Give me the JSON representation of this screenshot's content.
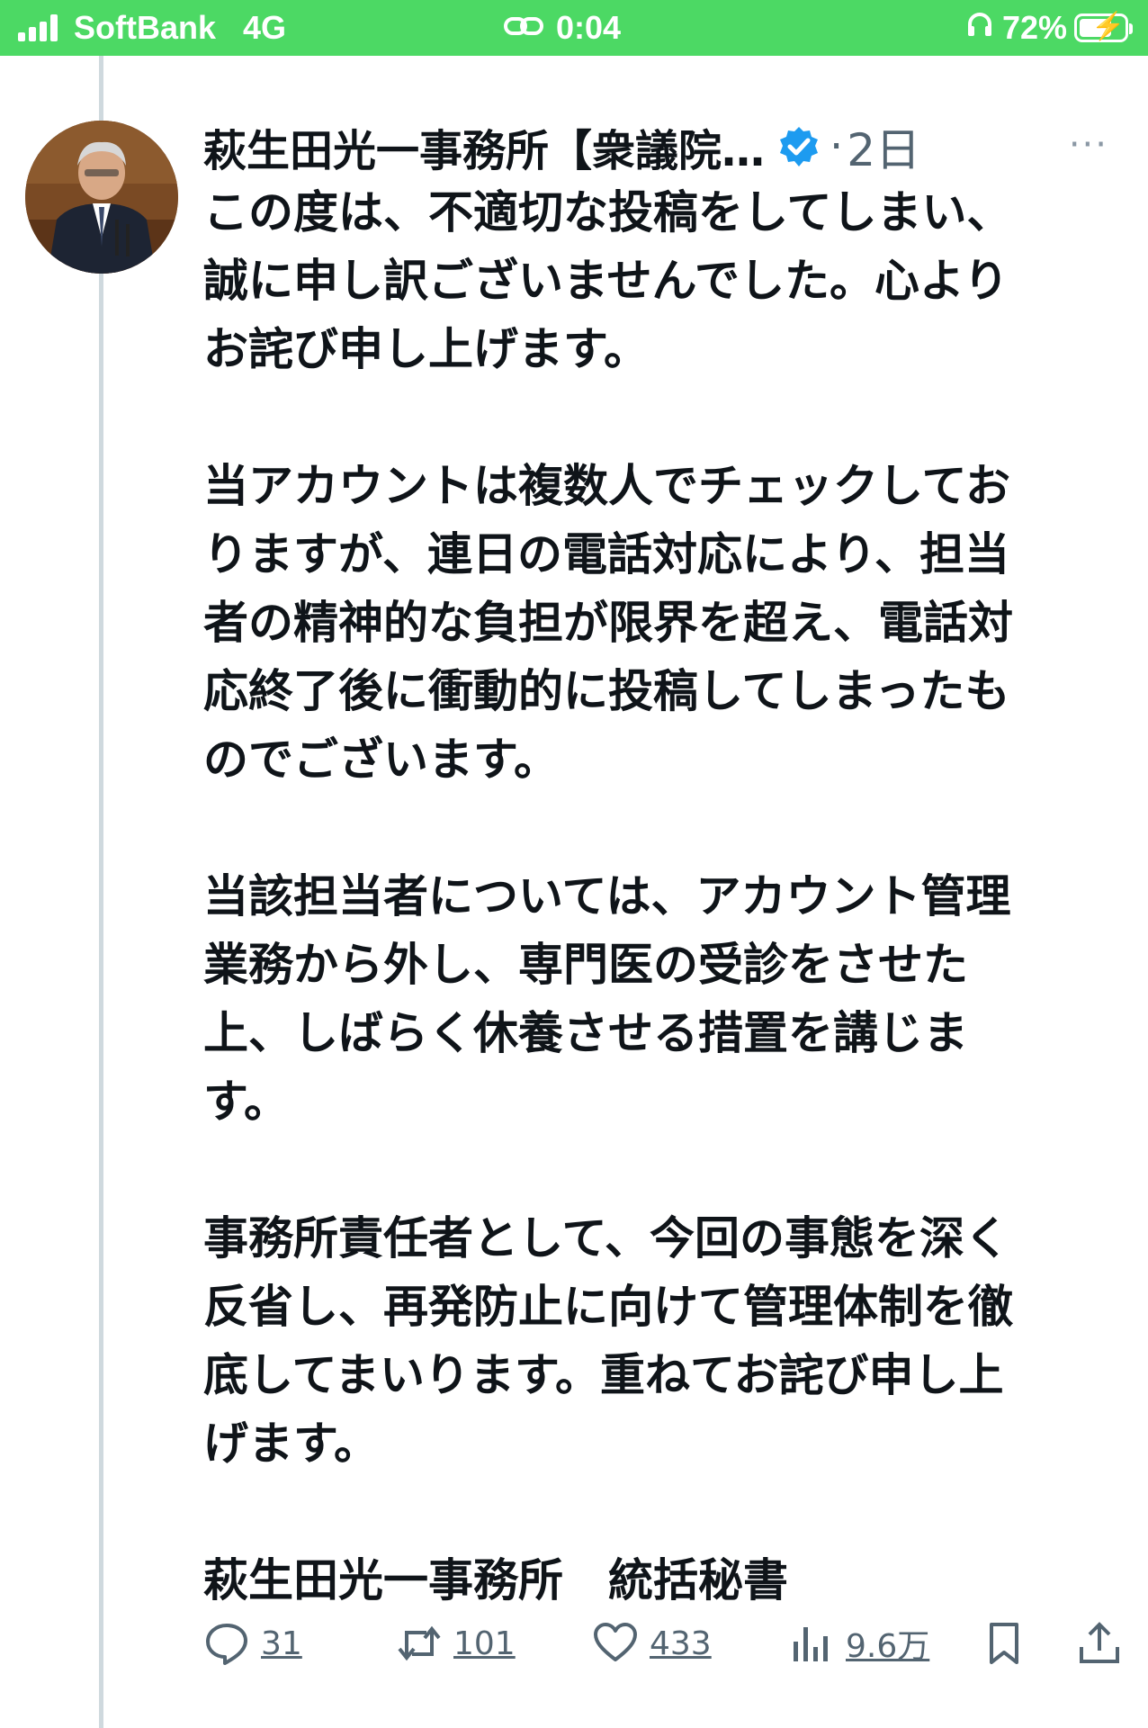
{
  "status_bar": {
    "carrier": "SoftBank",
    "network": "4G",
    "time": "0:04",
    "battery": "72%",
    "battery_level": 0.72,
    "bar_color": "#4cd964"
  },
  "tweet": {
    "author": "萩生田光一事務所【衆議院…",
    "verified_color": "#1d9bf0",
    "separator": "·",
    "time": "2日",
    "more": "···",
    "body": "この度は、不適切な投稿をしてしまい、\n誠に申し訳ございませんでした。心より\nお詫び申し上げます。\n\n当アカウントは複数人でチェックしてお\nりますが、連日の電話対応により、担当\n者の精神的な負担が限界を超え、電話対\n応終了後に衝動的に投稿してしまったも\nのでございます。\n\n当該担当者については、アカウント管理\n業務から外し、専門医の受診をさせた\n上、しばらく休養させる措置を講じま\nす。\n\n事務所責任者として、今回の事態を深く\n反省し、再発防止に向けて管理体制を徹\n底してまいります。重ねてお詫び申し上\nげます。\n\n萩生田光一事務所　統括秘書"
  },
  "actions": {
    "replies": "31",
    "retweets": "101",
    "likes": "433",
    "views": "9.6万"
  }
}
